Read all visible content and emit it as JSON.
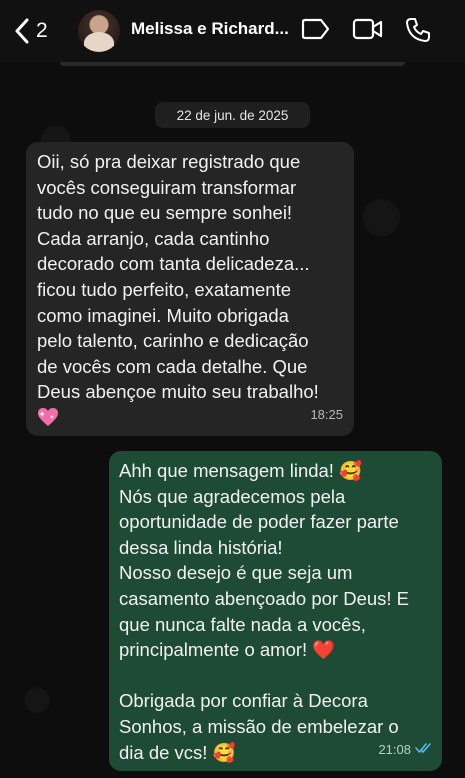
{
  "header": {
    "back_count": "2",
    "contact_name": "Melissa e Richard..."
  },
  "date_label": "22 de jun. de 2025",
  "messages": [
    {
      "direction": "incoming",
      "text": "Oii, só pra deixar registrado que\nvocês conseguiram transformar\ntudo no que eu sempre sonhei!\nCada arranjo, cada cantinho\ndecorado com tanta delicadeza...\nficou tudo perfeito, exatamente\ncomo imaginei. Muito obrigada\npelo talento, carinho e dedicação\nde vocês com cada detalhe. Que\nDeus abençoe muito seu trabalho!",
      "trailing_emoji": "💖",
      "time": "18:25"
    },
    {
      "direction": "outgoing",
      "text": "Ahh que mensagem linda! 🥰\nNós que agradecemos pela\noportunidade de poder fazer parte\ndessa linda história!\nNosso desejo é que seja um\ncasamento abençoado por Deus! E\nque nunca falte nada a vocês,\nprincipalmente o amor! ❤️\n\nObrigada por confiar à Decora\nSonhos, a missão de embelezar o\ndia de vcs! 🥰",
      "time": "21:08",
      "status": "read"
    }
  ],
  "colors": {
    "incoming_bubble": "#252525",
    "outgoing_bubble": "#1e4b35",
    "read_ticks": "#53bdeb"
  },
  "icons": [
    "chevron-left-icon",
    "label-icon",
    "video-call-icon",
    "phone-icon",
    "double-check-icon",
    "sparkling-heart-icon"
  ]
}
